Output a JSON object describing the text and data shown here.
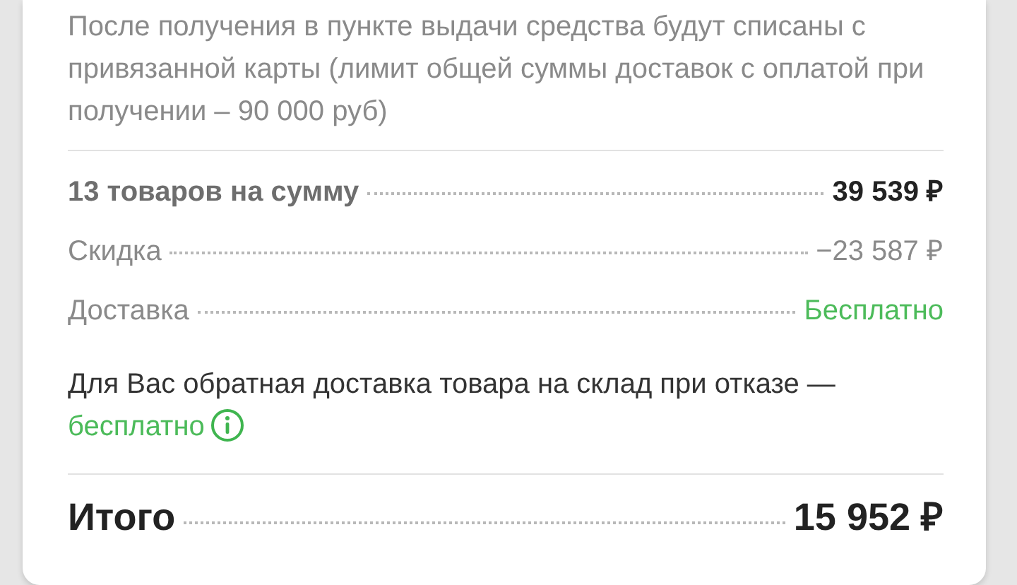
{
  "payment_notice": "После получения в пункте выдачи средства будут списаны с привязанной карты (лимит общей суммы доставок с оплатой при получении – 90 000 руб)",
  "summary_rows": [
    {
      "kind": "subtotal",
      "label": "13 товаров на сумму",
      "value": "39 539 ₽"
    },
    {
      "kind": "discount",
      "label": "Скидка",
      "value": "−23 587 ₽"
    },
    {
      "kind": "delivery",
      "label": "Доставка",
      "value": "Бесплатно"
    }
  ],
  "return_note": {
    "text": "Для Вас обратная доставка товара на склад при отказе —",
    "highlight": "бесплатно"
  },
  "total": {
    "label": "Итого",
    "value": "15 952 ₽"
  }
}
